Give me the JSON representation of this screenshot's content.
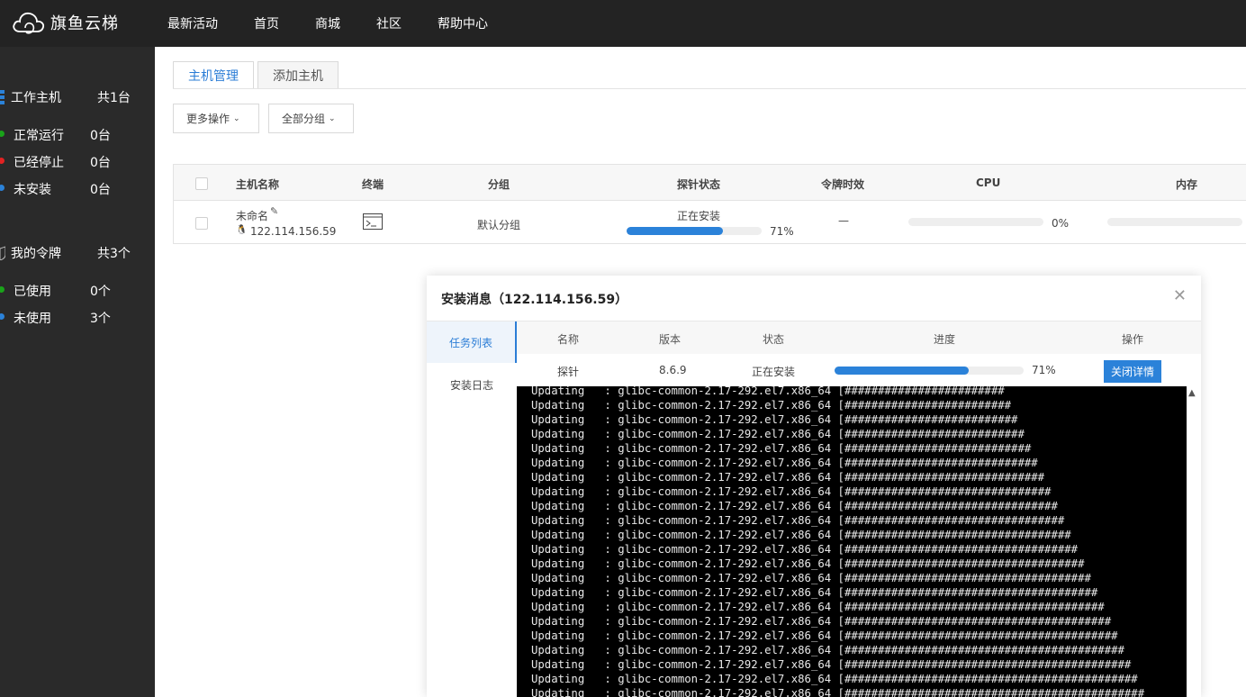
{
  "header": {
    "brand": "旗鱼云梯",
    "nav": [
      "最新活动",
      "首页",
      "商城",
      "社区",
      "帮助中心"
    ]
  },
  "sidebar": {
    "hosts": {
      "label": "工作主机",
      "count": "共1台",
      "items": [
        {
          "label": "正常运行",
          "count": "0台",
          "color": "#1aa31a"
        },
        {
          "label": "已经停止",
          "count": "0台",
          "color": "#e22222"
        },
        {
          "label": "未安装",
          "count": "0台",
          "color": "#2b82d9"
        }
      ]
    },
    "tokens": {
      "label": "我的令牌",
      "count": "共3个",
      "items": [
        {
          "label": "已使用",
          "count": "0个",
          "color": "#1aa31a"
        },
        {
          "label": "未使用",
          "count": "3个",
          "color": "#2b82d9"
        }
      ]
    }
  },
  "tabs": [
    "主机管理",
    "添加主机"
  ],
  "toolbar": {
    "more_ops": "更多操作",
    "all_groups": "全部分组"
  },
  "table": {
    "headers": [
      "主机名称",
      "终端",
      "分组",
      "探针状态",
      "令牌时效",
      "CPU",
      "内存"
    ],
    "row": {
      "name": "未命名",
      "ip": "122.114.156.59",
      "group": "默认分组",
      "probe_status": "正在安装",
      "probe_percent": "71%",
      "probe_progress": 0.71,
      "token_validity": "—",
      "cpu_percent": "0%",
      "cpu_progress": 0
    }
  },
  "modal": {
    "title": "安装消息（122.114.156.59）",
    "side": [
      "任务列表",
      "安装日志"
    ],
    "headers": [
      "名称",
      "版本",
      "状态",
      "进度",
      "操作"
    ],
    "task": {
      "name": "探针",
      "version": "8.6.9",
      "status": "正在安装",
      "percent": "71%",
      "progress": 0.71,
      "action": "关闭详情"
    },
    "log_prefix": "Updating   : glibc-common-2.17-292.el7.x86_64 [",
    "log_hash_counts": [
      24,
      25,
      26,
      27,
      28,
      29,
      30,
      31,
      32,
      33,
      34,
      35,
      36,
      37,
      38,
      39,
      40,
      41,
      42,
      43,
      44,
      45
    ]
  }
}
